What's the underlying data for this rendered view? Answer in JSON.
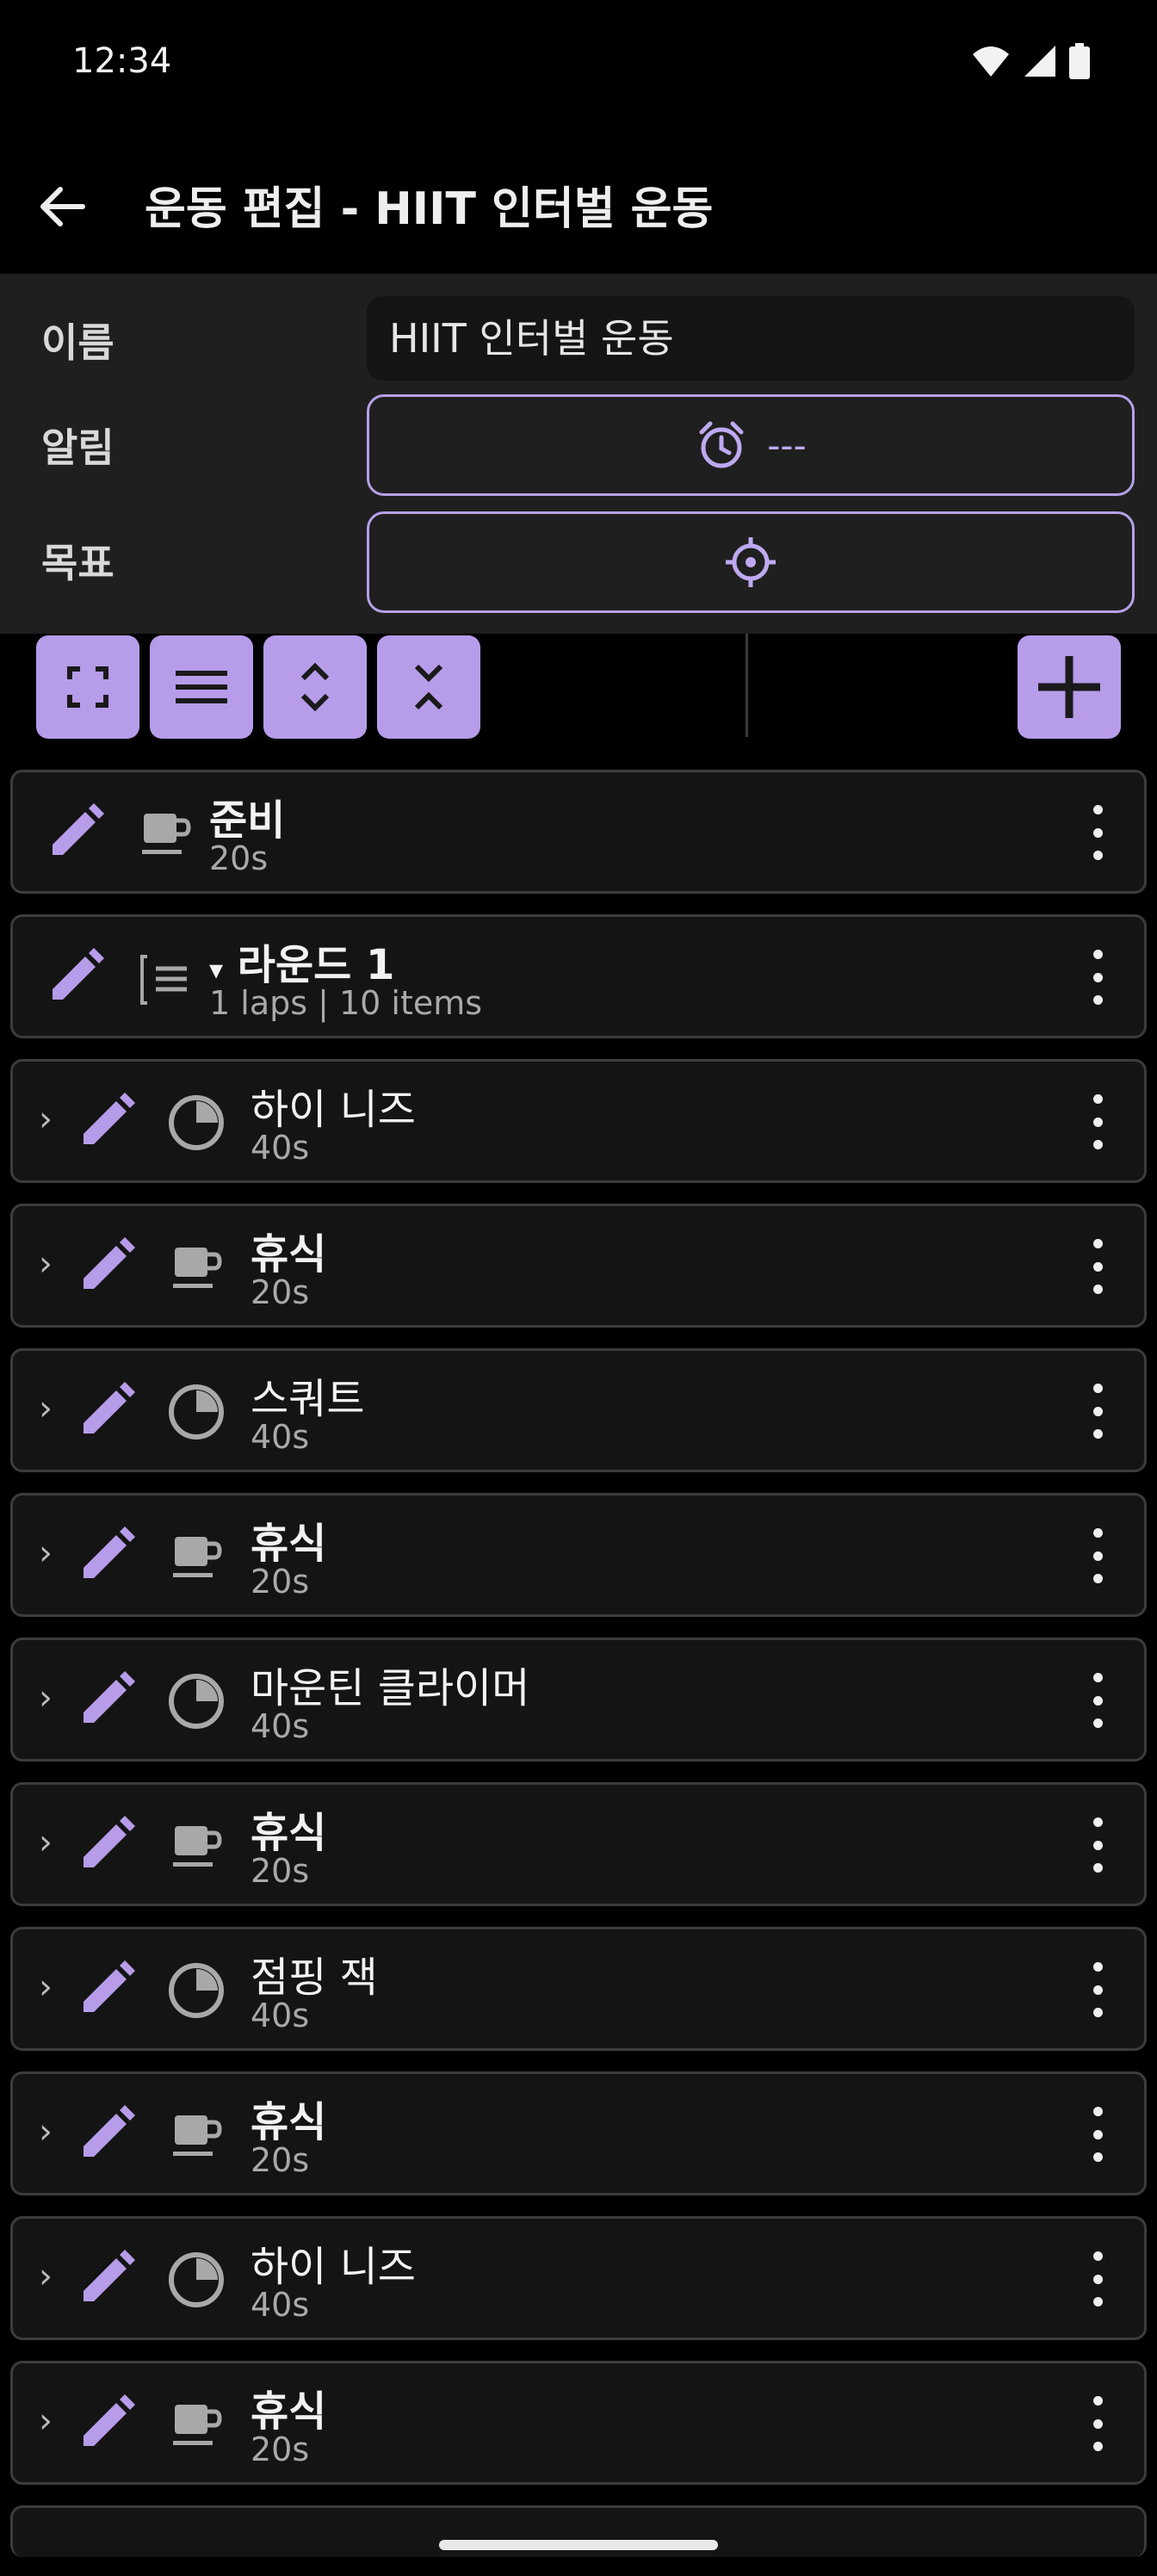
{
  "status": {
    "time": "12:34"
  },
  "app_bar": {
    "title": "운동 편집 - HIIT 인터벌 운동"
  },
  "form": {
    "name_label": "이름",
    "name_value": "HIIT 인터벌 운동",
    "alarm_label": "알림",
    "alarm_value": "---",
    "goal_label": "목표"
  },
  "colors": {
    "accent": "#B79CEA",
    "item_bg": "#141414",
    "panel_bg": "#1F1F1F"
  },
  "items": [
    {
      "title": "준비",
      "subtitle": "20s",
      "icon": "coffee-icon",
      "bold": true
    },
    {
      "title": "라운드 1",
      "prefix": "▾",
      "subtitle": "1 laps | 10 items",
      "icon": "list-icon",
      "bold": true
    },
    {
      "title": "하이 니즈",
      "subtitle": "40s",
      "icon": "timer-icon",
      "bold": false
    },
    {
      "title": "휴식",
      "subtitle": "20s",
      "icon": "coffee-icon",
      "bold": true
    },
    {
      "title": "스쿼트",
      "subtitle": "40s",
      "icon": "timer-icon",
      "bold": false
    },
    {
      "title": "휴식",
      "subtitle": "20s",
      "icon": "coffee-icon",
      "bold": true
    },
    {
      "title": "마운틴 클라이머",
      "subtitle": "40s",
      "icon": "timer-icon",
      "bold": false
    },
    {
      "title": "휴식",
      "subtitle": "20s",
      "icon": "coffee-icon",
      "bold": true
    },
    {
      "title": "점핑 잭",
      "subtitle": "40s",
      "icon": "timer-icon",
      "bold": false
    },
    {
      "title": "휴식",
      "subtitle": "20s",
      "icon": "coffee-icon",
      "bold": true
    },
    {
      "title": "하이 니즈",
      "subtitle": "40s",
      "icon": "timer-icon",
      "bold": false
    },
    {
      "title": "휴식",
      "subtitle": "20s",
      "icon": "coffee-icon",
      "bold": true
    }
  ]
}
